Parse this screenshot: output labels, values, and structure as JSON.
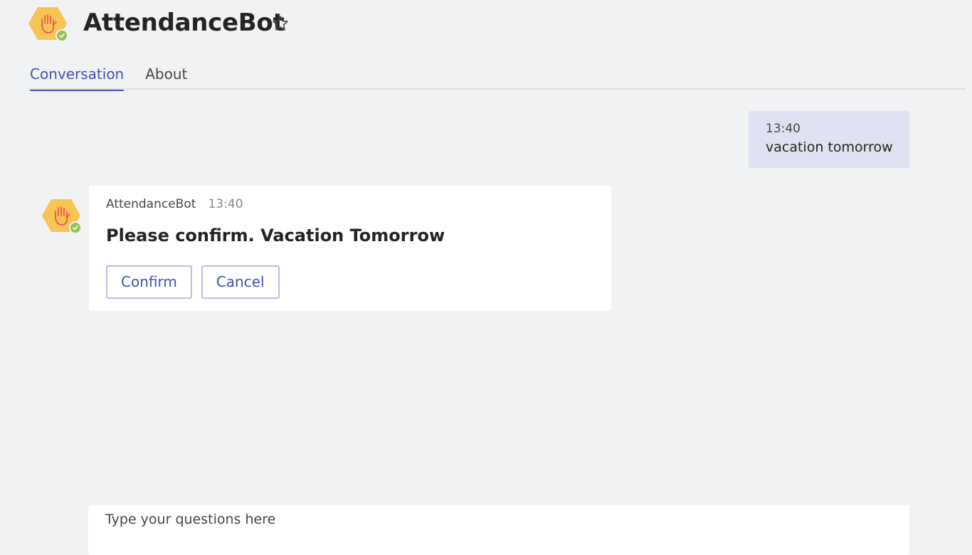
{
  "header": {
    "title": "AttendanceBot",
    "avatar_icon": "raised-hand-icon",
    "presence_icon": "checkmark-icon",
    "favorite_icon": "star-outline-icon"
  },
  "tabs": [
    {
      "label": "Conversation",
      "active": true
    },
    {
      "label": "About",
      "active": false
    }
  ],
  "messages": {
    "user": {
      "time": "13:40",
      "text": "vacation tomorrow"
    },
    "bot": {
      "sender": "AttendanceBot",
      "time": "13:40",
      "heading": "Please confirm. Vacation Tomorrow",
      "actions": [
        {
          "label": "Confirm"
        },
        {
          "label": "Cancel"
        }
      ]
    }
  },
  "compose": {
    "placeholder": "Type your questions here",
    "value": ""
  },
  "colors": {
    "background": "#f1f2f4",
    "accent": "#464eb8",
    "avatar_fill": "#f8c453",
    "hand": "#e8574d",
    "presence": "#92c353",
    "user_bubble": "#e0e2f3"
  }
}
